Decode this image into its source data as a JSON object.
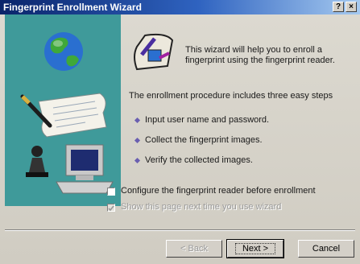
{
  "window": {
    "title": "Fingerprint Enrollment Wizard",
    "help_button": "?",
    "close_button": "×"
  },
  "intro": {
    "line1": "This wizard will help you to enroll a",
    "line2": "fingerprint using the fingerprint reader."
  },
  "procedure": {
    "heading": "The enrollment procedure includes three easy steps",
    "steps": [
      "Input user name and password.",
      "Collect the fingerprint images.",
      "Verify the collected images."
    ]
  },
  "options": {
    "configure_label": "Configure the  fingerprint reader before enrollment",
    "configure_checked": false,
    "show_page_label": "Show this page next time you use wizard",
    "show_page_checked": true
  },
  "buttons": {
    "back": "< Back",
    "next": "Next >",
    "cancel": "Cancel"
  },
  "colors": {
    "title_bar": "#0a246a",
    "side_panel": "#3f9a9a",
    "bullet": "#6a5fb0"
  }
}
